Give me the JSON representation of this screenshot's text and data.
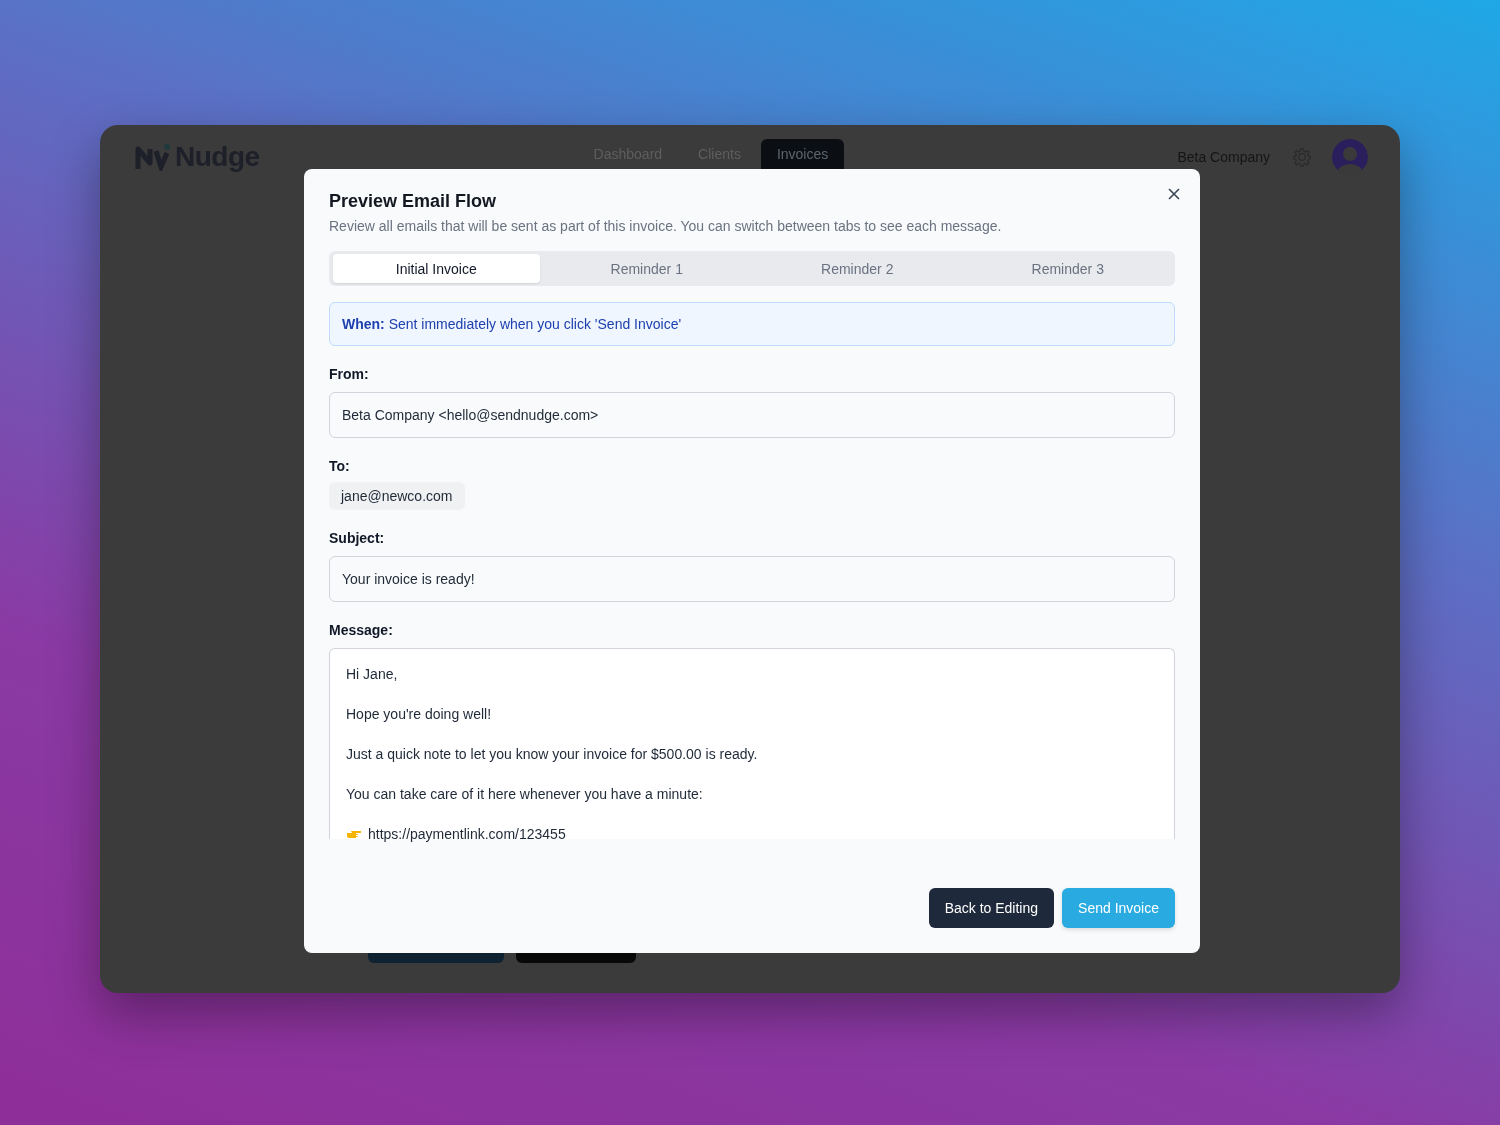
{
  "app": {
    "logo": "Nudge",
    "nav": [
      {
        "label": "Dashboard",
        "selected": false
      },
      {
        "label": "Clients",
        "selected": false
      },
      {
        "label": "Invoices",
        "selected": true
      }
    ],
    "company": "Beta Company"
  },
  "dialog": {
    "title": "Preview Email Flow",
    "subtitle": "Review all emails that will be sent as part of this invoice. You can switch between tabs to see each message.",
    "tabs": [
      {
        "label": "Initial Invoice",
        "selected": true
      },
      {
        "label": "Reminder 1",
        "selected": false
      },
      {
        "label": "Reminder 2",
        "selected": false
      },
      {
        "label": "Reminder 3",
        "selected": false
      }
    ],
    "when": "**When:** Sent immediately when you click 'Send Invoice'",
    "from": {
      "label": "From:",
      "value": "Beta Company <hello@sendnudge.com>"
    },
    "to": {
      "label": "To:",
      "value": "jane@newco.com"
    },
    "subject": {
      "label": "Subject:",
      "value": "Your invoice is ready!"
    },
    "message": {
      "label": "Message:",
      "lines": [
        {
          "kind": "text",
          "text": "Hi Jane,"
        },
        {
          "kind": "text",
          "text": "Hope you're doing well!"
        },
        {
          "kind": "text",
          "text": "Just a quick note to let you know your invoice for $500.00 is ready."
        },
        {
          "kind": "text",
          "text": "You can take care of it here whenever you have a minute:"
        },
        {
          "kind": "link",
          "text": "https://paymentlink.com/123455"
        }
      ]
    },
    "buttons": [
      {
        "label": "Back to Editing",
        "kind": "secondary"
      },
      {
        "label": "Send Invoice",
        "kind": "primary"
      }
    ]
  }
}
